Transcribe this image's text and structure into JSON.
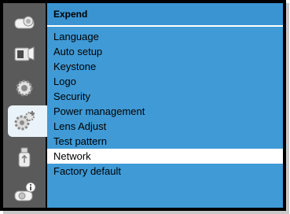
{
  "colors": {
    "panel_bg": "#3f9ad6",
    "sidebar_bg": "#5a5a5a",
    "selected_row": "#ffffff",
    "active_icon_bg": "#eaf3fa"
  },
  "sidebar": {
    "items": [
      {
        "icon": "projector-display-icon"
      },
      {
        "icon": "input-source-icon"
      },
      {
        "icon": "settings-gear-icon"
      },
      {
        "icon": "expand-gear-plus-icon",
        "active": true
      },
      {
        "icon": "usb-drive-icon"
      },
      {
        "icon": "projector-info-icon"
      }
    ]
  },
  "header": {
    "title": "Expend"
  },
  "menu": {
    "selected": "Network",
    "items": [
      "Language",
      "Auto setup",
      "Keystone",
      "Logo",
      "Security",
      "Power management",
      "Lens Adjust",
      "Test pattern",
      "Network",
      "Factory default"
    ]
  }
}
